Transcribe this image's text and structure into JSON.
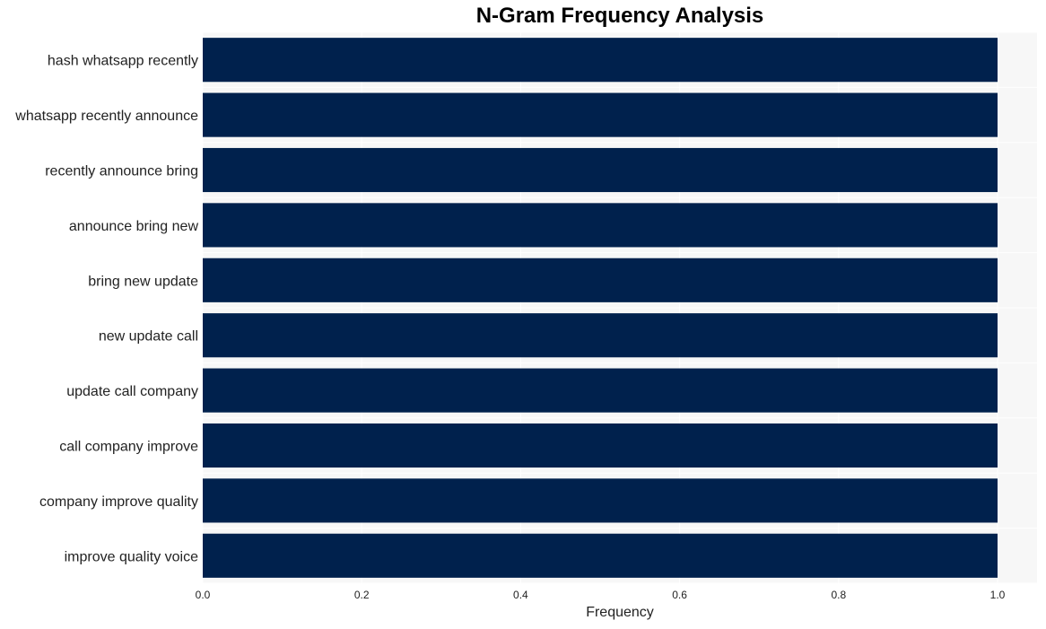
{
  "chart_data": {
    "type": "bar",
    "orientation": "horizontal",
    "title": "N-Gram Frequency Analysis",
    "xlabel": "Frequency",
    "ylabel": "",
    "categories": [
      "hash whatsapp recently",
      "whatsapp recently announce",
      "recently announce bring",
      "announce bring new",
      "bring new update",
      "new update call",
      "update call company",
      "call company improve",
      "company improve quality",
      "improve quality voice"
    ],
    "values": [
      1,
      1,
      1,
      1,
      1,
      1,
      1,
      1,
      1,
      1
    ],
    "xlim": [
      0,
      1.05
    ],
    "xticks": [
      "0.0",
      "0.2",
      "0.4",
      "0.6",
      "0.8",
      "1.0"
    ],
    "xtick_values": [
      0,
      0.2,
      0.4,
      0.6,
      0.8,
      1.0
    ],
    "grid": true,
    "bar_color": "#00214d",
    "plot_background": "#f7f7f7"
  }
}
